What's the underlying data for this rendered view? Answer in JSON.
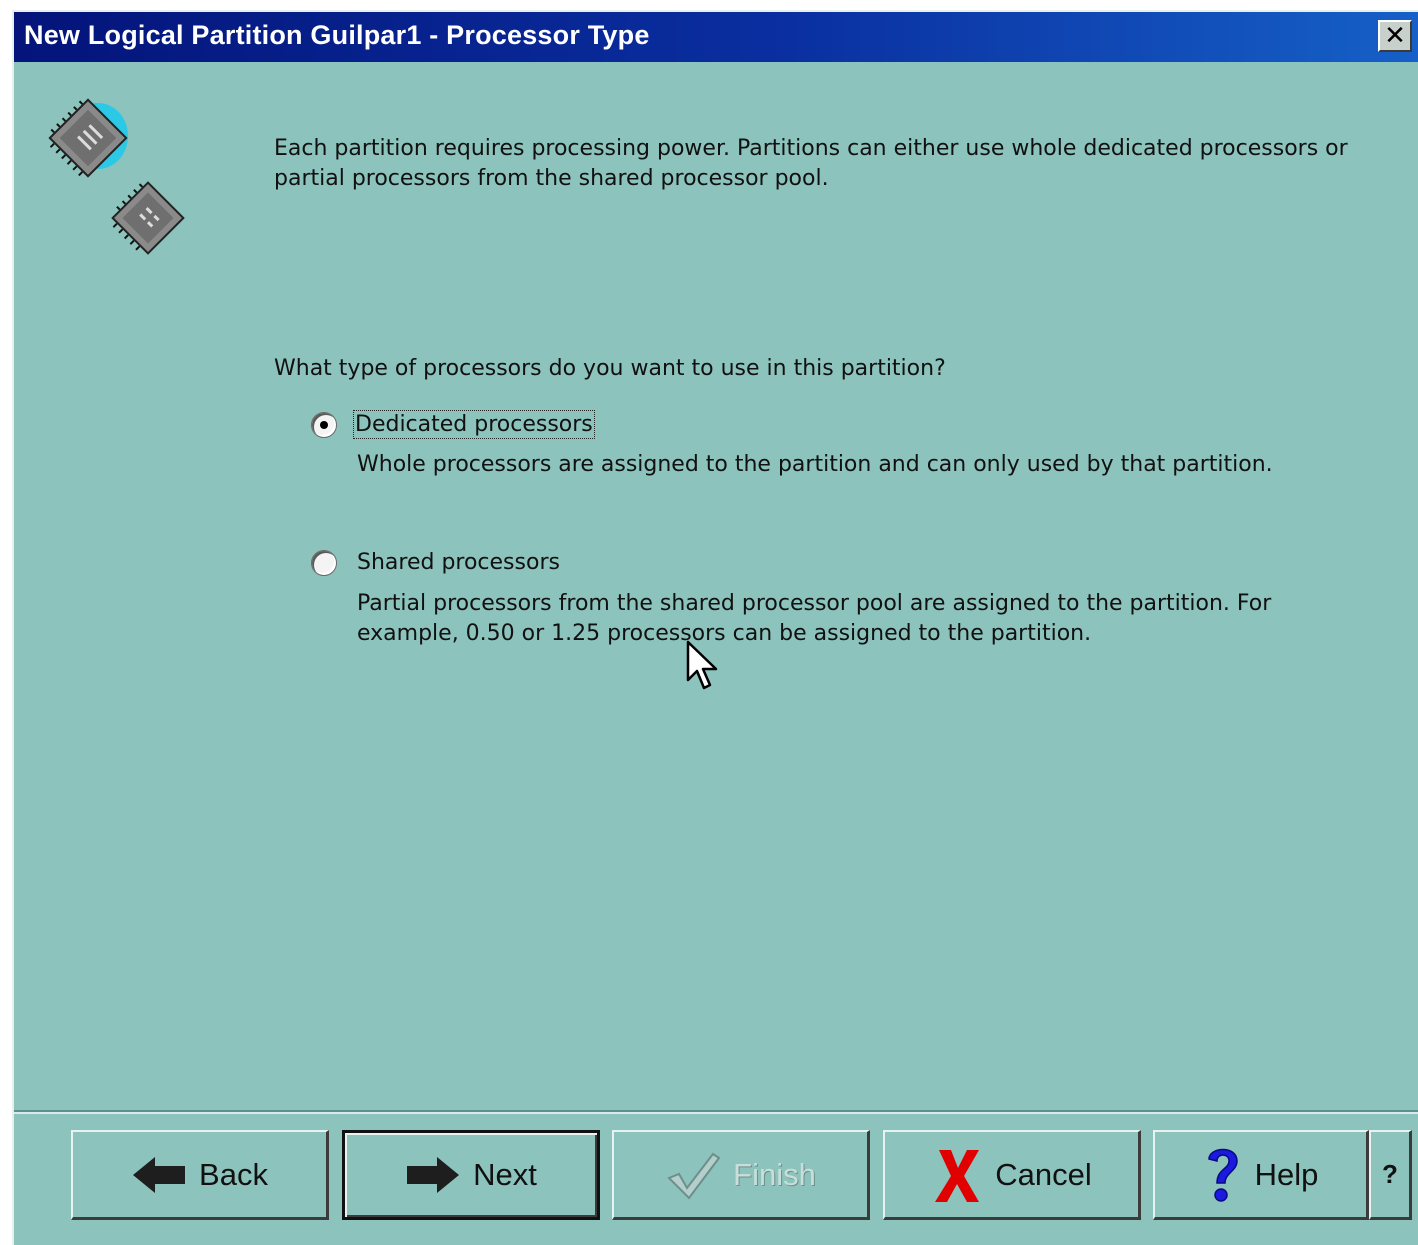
{
  "window": {
    "title": "New Logical Partition Guilpar1 - Processor Type",
    "close_label": "✕"
  },
  "content": {
    "intro": "Each partition requires processing power.  Partitions can either use whole dedicated processors or partial processors from the shared processor pool.",
    "question": "What type of processors do you want to use in this partition?",
    "options": [
      {
        "label": "Dedicated processors",
        "description": "Whole processors are assigned to the partition and can only used by that partition.",
        "selected": true
      },
      {
        "label": "Shared processors",
        "description_line1": "Partial processors from the shared processor pool are assigned to the partition.  For",
        "description_line2": "example, 0.50 or 1.25 processors can be assigned to the partition.",
        "selected": false
      }
    ]
  },
  "buttons": {
    "back": "Back",
    "next": "Next",
    "finish": "Finish",
    "cancel": "Cancel",
    "help": "Help",
    "whats_this": "?"
  },
  "colors": {
    "background": "#8cc3bd",
    "titlebar": "#0a2fa0",
    "cancel_icon": "#e00000",
    "help_icon": "#1a1ae0",
    "finish_disabled": "#c9dedb"
  },
  "icons": [
    "processor-chip-icon",
    "processor-chip-icon",
    "left-arrow-icon",
    "right-arrow-icon",
    "checkmark-icon",
    "x-icon",
    "question-mark-icon",
    "mouse-pointer-icon"
  ]
}
